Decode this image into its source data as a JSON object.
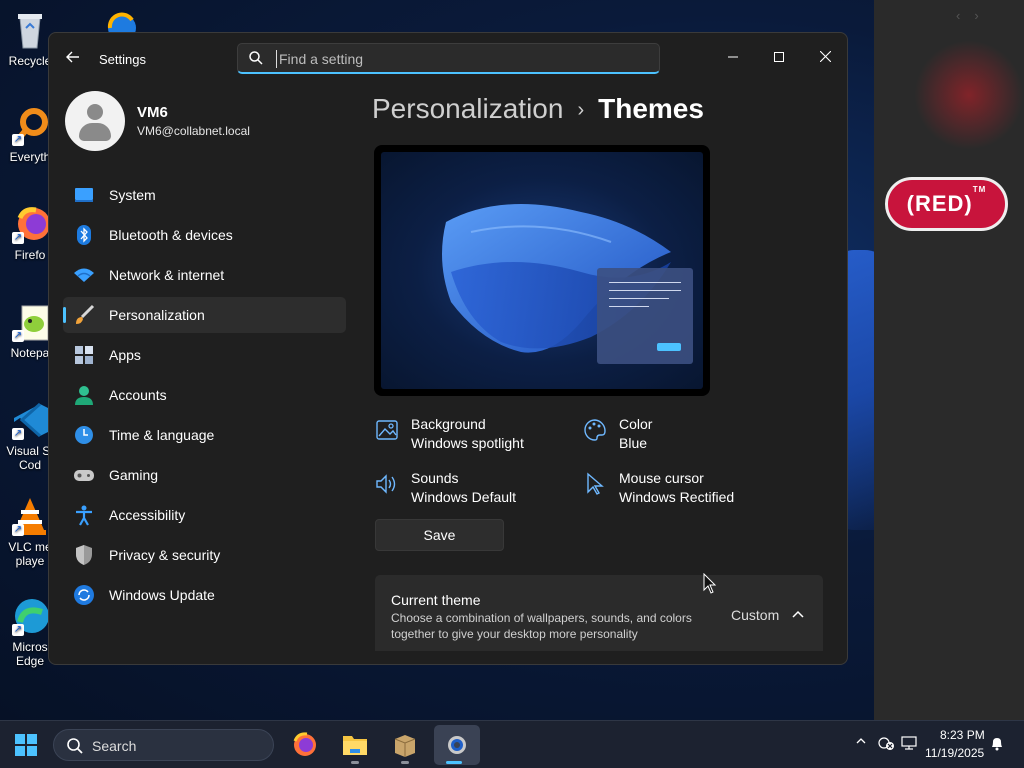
{
  "desktop": {
    "icons": [
      {
        "label": "Recycle",
        "icon": "recycle-bin-icon"
      },
      {
        "label": "Everyth",
        "icon": "everything-search-icon"
      },
      {
        "label": "Firefo",
        "icon": "firefox-icon"
      },
      {
        "label": "Notepa",
        "icon": "notepad-plus-icon"
      },
      {
        "label": "Visual St Cod",
        "icon": "vscode-icon"
      },
      {
        "label": "VLC me playe",
        "icon": "vlc-icon"
      },
      {
        "label": "Micros Edge",
        "icon": "edge-icon"
      }
    ],
    "badge_text": "(RED)",
    "badge_mark": "TM"
  },
  "settings": {
    "app_title": "Settings",
    "search": {
      "placeholder": "Find a setting",
      "value": ""
    },
    "profile": {
      "name": "VM6",
      "email": "VM6@collabnet.local"
    },
    "nav": [
      {
        "label": "System",
        "icon": "system-display-icon"
      },
      {
        "label": "Bluetooth & devices",
        "icon": "bluetooth-icon"
      },
      {
        "label": "Network & internet",
        "icon": "wifi-icon"
      },
      {
        "label": "Personalization",
        "icon": "paintbrush-icon",
        "active": true
      },
      {
        "label": "Apps",
        "icon": "apps-icon"
      },
      {
        "label": "Accounts",
        "icon": "accounts-icon"
      },
      {
        "label": "Time & language",
        "icon": "time-language-icon"
      },
      {
        "label": "Gaming",
        "icon": "gamepad-icon"
      },
      {
        "label": "Accessibility",
        "icon": "accessibility-icon"
      },
      {
        "label": "Privacy & security",
        "icon": "shield-icon"
      },
      {
        "label": "Windows Update",
        "icon": "windows-update-icon"
      }
    ],
    "breadcrumb": {
      "parent": "Personalization",
      "separator": "›",
      "current": "Themes"
    },
    "properties": {
      "background": {
        "title": "Background",
        "value": "Windows spotlight"
      },
      "color": {
        "title": "Color",
        "value": "Blue"
      },
      "sounds": {
        "title": "Sounds",
        "value": "Windows Default"
      },
      "mouse_cursor": {
        "title": "Mouse cursor",
        "value": "Windows Rectified"
      }
    },
    "save_label": "Save",
    "current_theme": {
      "title": "Current theme",
      "description": "Choose a combination of wallpapers, sounds, and colors together to give your desktop more personality",
      "value": "Custom"
    },
    "accent_color": "#4cc2ff"
  },
  "taskbar": {
    "search_label": "Search",
    "apps": [
      "firefox-icon",
      "file-explorer-icon",
      "archive-icon",
      "settings-gear-icon"
    ],
    "time": "8:23 PM",
    "date": "11/19/2025"
  }
}
